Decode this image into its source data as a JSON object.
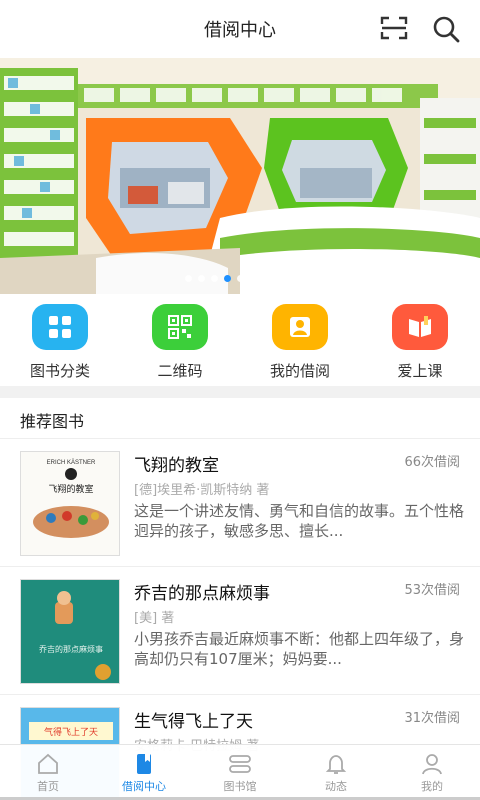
{
  "header": {
    "title": "借阅中心",
    "scan_icon": "scan-icon",
    "search_icon": "search-icon"
  },
  "banner": {
    "slide_count": 9,
    "active_index": 3
  },
  "quick_menu": [
    {
      "label": "图书分类",
      "icon": "grid-icon",
      "color": "#27b3f0"
    },
    {
      "label": "二维码",
      "icon": "qr-code-icon",
      "color": "#3ccf3a"
    },
    {
      "label": "我的借阅",
      "icon": "user-icon",
      "color": "#ffb400"
    },
    {
      "label": "爱上课",
      "icon": "book-open-icon",
      "color": "#ff5a3c"
    }
  ],
  "section": {
    "title": "推荐图书"
  },
  "books": [
    {
      "title": "飞翔的教室",
      "count": "66次借阅",
      "author": "[德]埃里希·凯斯特纳 著",
      "desc": "这是一个讲述友情、勇气和自信的故事。五个性格迥异的孩子，敏感多思、擅长...",
      "cover_text": "飞翔的教室",
      "cover_top": "ERICH KÄSTNER"
    },
    {
      "title": "乔吉的那点麻烦事",
      "count": "53次借阅",
      "author": "[美] 著",
      "desc": "小男孩乔吉最近麻烦事不断：他都上四年级了，身高却仍只有107厘米；妈妈要...",
      "cover_text": "乔吉的那点麻烦事"
    },
    {
      "title": "生气得飞上了天",
      "count": "31次借阅",
      "author": "安格莉卡·巴特拉姆 著",
      "desc": "",
      "cover_text": "气得飞上了天"
    }
  ],
  "tabbar": [
    {
      "label": "首页",
      "icon": "home-icon",
      "active": false
    },
    {
      "label": "借阅中心",
      "icon": "bookmark-book-icon",
      "active": true
    },
    {
      "label": "图书馆",
      "icon": "library-icon",
      "active": false
    },
    {
      "label": "动态",
      "icon": "bell-icon",
      "active": false
    },
    {
      "label": "我的",
      "icon": "profile-icon",
      "active": false
    }
  ],
  "colors": {
    "accent": "#1e88e5",
    "banner_orange": "#ff7a1a",
    "banner_green": "#5cc31f"
  }
}
